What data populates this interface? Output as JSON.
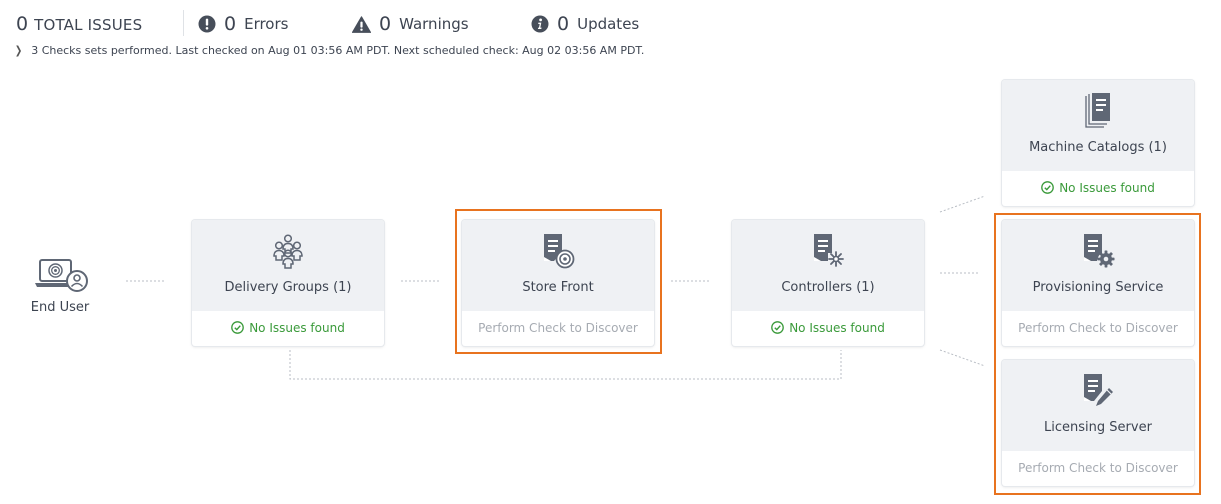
{
  "summary": {
    "total": {
      "count": "0",
      "label": "TOTAL ISSUES"
    },
    "errors": {
      "count": "0",
      "label": "Errors",
      "icon": "error-circle-icon"
    },
    "warnings": {
      "count": "0",
      "label": "Warnings",
      "icon": "warning-triangle-icon"
    },
    "updates": {
      "count": "0",
      "label": "Updates",
      "icon": "info-circle-icon"
    }
  },
  "check_info": {
    "text": "3 Checks sets performed. Last checked on Aug 01 03:56 AM PDT. Next scheduled check: Aug 02 03:56 AM PDT.",
    "icon": "chevron-right-icon"
  },
  "end_user": {
    "label": "End User",
    "icon": "end-user-laptop-icon"
  },
  "nodes": {
    "delivery_groups": {
      "title": "Delivery Groups (1)",
      "status": "No Issues found",
      "icon": "delivery-groups-icon"
    },
    "store_front": {
      "title": "Store Front",
      "status": "Perform Check to Discover",
      "icon": "store-front-icon"
    },
    "controllers": {
      "title": "Controllers (1)",
      "status": "No Issues found",
      "icon": "controllers-icon"
    },
    "machine_catalogs": {
      "title": "Machine Catalogs (1)",
      "status": "No Issues found",
      "icon": "machine-catalogs-icon"
    },
    "provisioning_service": {
      "title": "Provisioning Service",
      "status": "Perform Check to Discover",
      "icon": "provisioning-service-icon"
    },
    "licensing_server": {
      "title": "Licensing Server",
      "status": "Perform Check to Discover",
      "icon": "licensing-server-icon"
    }
  },
  "colors": {
    "highlight_border": "#e8731f",
    "ok_text": "#3a9a3a",
    "pending_text": "#a6abb2",
    "card_header": "#eff1f4",
    "icon": "#5f6775"
  }
}
